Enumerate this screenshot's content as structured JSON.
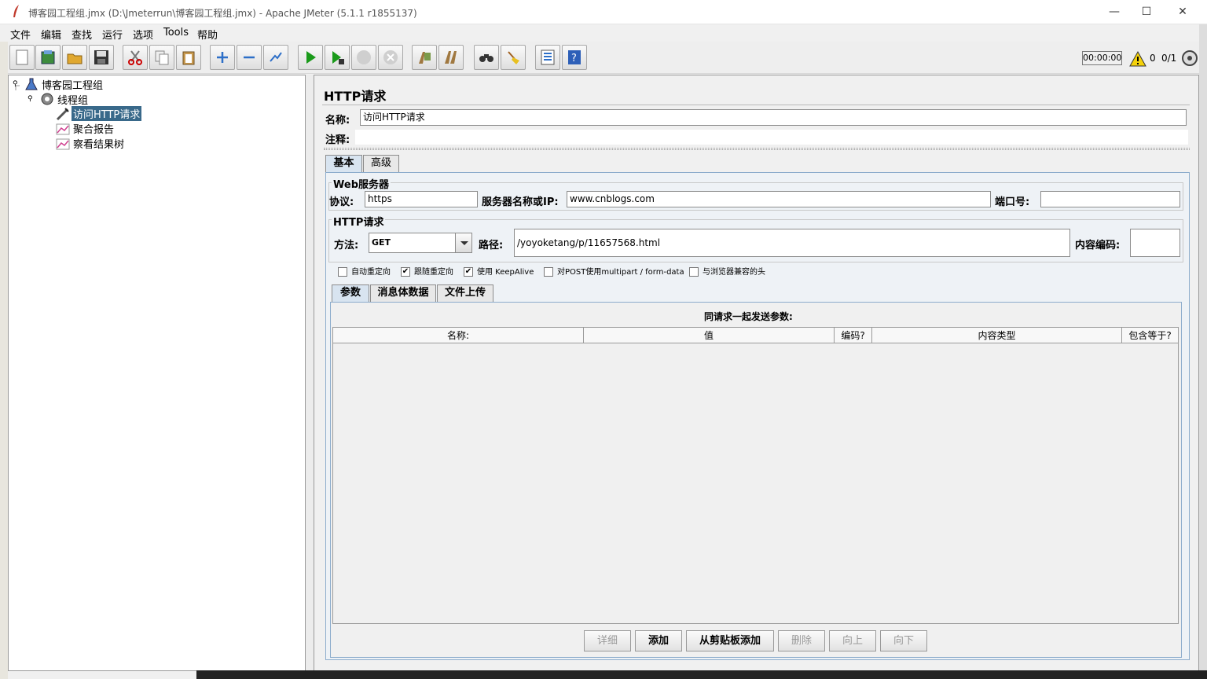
{
  "window": {
    "title": "博客园工程组.jmx (D:\\Jmeterrun\\博客园工程组.jmx) - Apache JMeter (5.1.1 r1855137)",
    "minimize": "—",
    "maximize": "☐",
    "close": "✕"
  },
  "menu": [
    "文件",
    "编辑",
    "查找",
    "运行",
    "选项",
    "Tools",
    "帮助"
  ],
  "toolbar": {
    "timer": "00:00:00",
    "warnings": "0",
    "threads": "0/1",
    "icons": [
      "new-icon",
      "templates-icon",
      "open-icon",
      "save-icon",
      "cut-icon",
      "copy-icon",
      "paste-icon",
      "expand-icon",
      "collapse-icon",
      "toggle-icon",
      "start-icon",
      "start-no-pause-icon",
      "stop-icon",
      "shutdown-icon",
      "clear-icon",
      "clear-all-icon",
      "search-icon",
      "reset-search-icon",
      "function-helper-icon",
      "help-icon"
    ]
  },
  "tree": {
    "nodes": [
      {
        "label": "博客园工程组",
        "icon": "test-plan-icon"
      },
      {
        "label": "线程组",
        "icon": "thread-group-icon"
      },
      {
        "label": "访问HTTP请求",
        "icon": "sampler-icon"
      },
      {
        "label": "聚合报告",
        "icon": "listener-icon"
      },
      {
        "label": "察看结果树",
        "icon": "listener-icon"
      }
    ]
  },
  "panel": {
    "title": "HTTP请求",
    "name_label": "名称:",
    "name_value": "访问HTTP请求",
    "comment_label": "注释:",
    "comment_value": "",
    "tabs": [
      "基本",
      "高级"
    ],
    "web_server": {
      "legend": "Web服务器",
      "protocol_label": "协议:",
      "protocol_value": "https",
      "server_label": "服务器名称或IP:",
      "server_value": "www.cnblogs.com",
      "port_label": "端口号:",
      "port_value": ""
    },
    "http_request": {
      "legend": "HTTP请求",
      "method_label": "方法:",
      "method_value": "GET",
      "path_label": "路径:",
      "path_value": "/yoyoketang/p/11657568.html",
      "encoding_label": "内容编码:",
      "encoding_value": ""
    },
    "checkboxes": [
      {
        "label": "自动重定向",
        "checked": false
      },
      {
        "label": "跟随重定向",
        "checked": true
      },
      {
        "label": "使用 KeepAlive",
        "checked": true
      },
      {
        "label": "对POST使用multipart / form-data",
        "checked": false
      },
      {
        "label": "与浏览器兼容的头",
        "checked": false
      }
    ],
    "subtabs": [
      "参数",
      "消息体数据",
      "文件上传"
    ],
    "params_title": "同请求一起发送参数:",
    "columns": [
      "名称:",
      "值",
      "编码?",
      "内容类型",
      "包含等于?"
    ],
    "buttons": [
      "详细",
      "添加",
      "从剪贴板添加",
      "删除",
      "向上",
      "向下"
    ]
  }
}
